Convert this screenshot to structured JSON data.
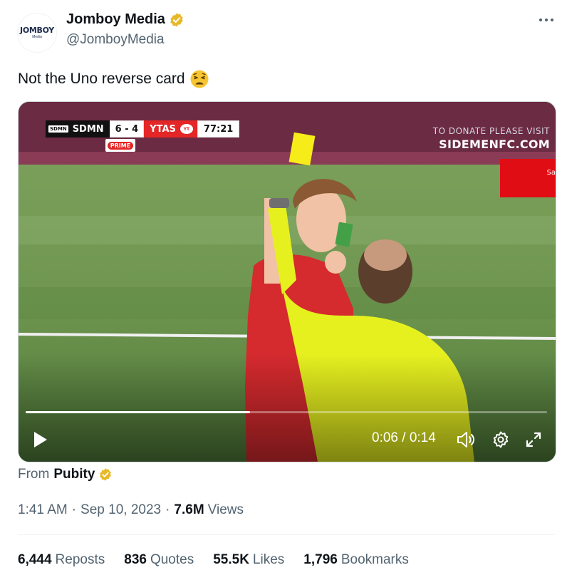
{
  "author": {
    "display_name": "Jomboy Media",
    "handle": "@JomboyMedia",
    "avatar_word": "JOMBOY",
    "avatar_sub": "Media"
  },
  "icons": {
    "verified": "verified-badge-icon",
    "more": "more-options-icon",
    "emoji": "weary-face-emoji"
  },
  "tweet": {
    "text": "Not the Uno reverse card"
  },
  "video": {
    "scoreboard": {
      "team_home": "SDMN",
      "team_home_logo": "SDMN",
      "score": "6 - 4",
      "team_away": "YTAS",
      "team_away_logo": "YT",
      "clock": "77:21",
      "sponsor": "PRIME"
    },
    "donate_line1": "TO DONATE PLEASE VISIT",
    "donate_line2": "SIDEMENFC.COM",
    "board_text": "Sa",
    "progress_fraction": 0.43,
    "time": "0:06 / 0:14"
  },
  "source": {
    "prefix": "From",
    "name": "Pubity"
  },
  "meta": {
    "time": "1:41 AM",
    "sep1": "·",
    "date": "Sep 10, 2023",
    "sep2": "·",
    "views_count": "7.6M",
    "views_label": "Views"
  },
  "stats": [
    {
      "count": "6,444",
      "label": "Reposts"
    },
    {
      "count": "836",
      "label": "Quotes"
    },
    {
      "count": "55.5K",
      "label": "Likes"
    },
    {
      "count": "1,796",
      "label": "Bookmarks"
    }
  ],
  "colors": {
    "text_primary": "#0f1419",
    "text_secondary": "#536471",
    "verified_gold": "#e8b829",
    "divider": "#eff3f4"
  }
}
